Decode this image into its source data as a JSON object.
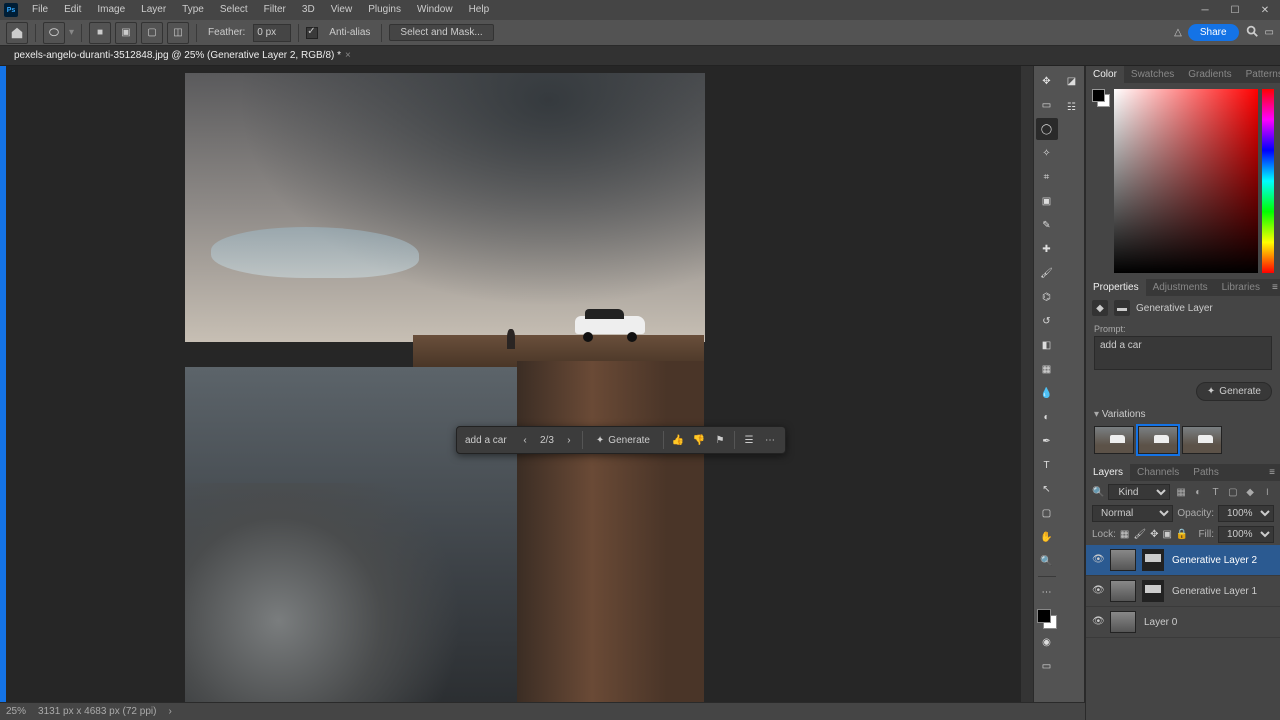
{
  "menubar": {
    "items": [
      "File",
      "Edit",
      "Image",
      "Layer",
      "Type",
      "Select",
      "Filter",
      "3D",
      "View",
      "Plugins",
      "Window",
      "Help"
    ]
  },
  "optionsbar": {
    "feather_label": "Feather:",
    "feather_value": "0 px",
    "antialias_label": "Anti-alias",
    "select_mask": "Select and Mask..."
  },
  "share_label": "Share",
  "doc_tab": "pexels-angelo-duranti-3512848.jpg @ 25% (Generative Layer 2, RGB/8) *",
  "context_bar": {
    "prompt": "add a car",
    "counter": "2/3",
    "generate": "Generate"
  },
  "panels": {
    "color_tabs": [
      "Color",
      "Swatches",
      "Gradients",
      "Patterns"
    ],
    "props_tabs": [
      "Properties",
      "Adjustments",
      "Libraries"
    ],
    "props_title": "Generative Layer",
    "prompt_label": "Prompt:",
    "prompt_value": "add a car",
    "generate_btn": "Generate",
    "variations_label": "Variations",
    "layers_tabs": [
      "Layers",
      "Channels",
      "Paths"
    ],
    "kind_label": "Kind",
    "blend_mode": "Normal",
    "opacity_label": "Opacity:",
    "opacity_value": "100%",
    "lock_label": "Lock:",
    "fill_label": "Fill:",
    "fill_value": "100%",
    "layers": [
      {
        "name": "Generative Layer 2",
        "sel": true,
        "mask": true
      },
      {
        "name": "Generative Layer 1",
        "sel": false,
        "mask": true
      },
      {
        "name": "Layer 0",
        "sel": false,
        "mask": false
      }
    ]
  },
  "statusbar": {
    "zoom": "25%",
    "dims": "3131 px x 4683 px (72 ppi)"
  }
}
